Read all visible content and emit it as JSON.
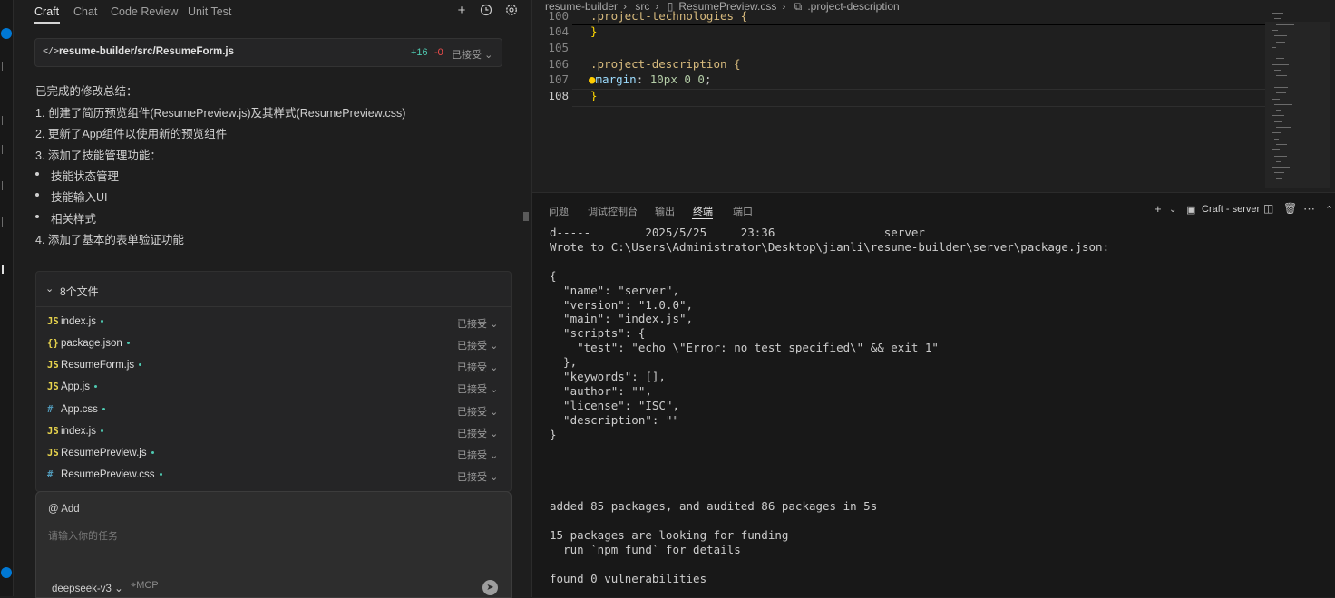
{
  "chat": {
    "tabs": [
      "Craft",
      "Chat",
      "Code Review",
      "Unit Test"
    ],
    "active_tab": "Craft",
    "header_icons": [
      "plus-icon",
      "history-icon",
      "settings-icon"
    ],
    "file_card": {
      "path": "resume-builder/src/ResumeForm.js",
      "added": "+16",
      "removed": "-0",
      "status": "已接受"
    },
    "summary": [
      "已完成的修改总结：",
      "1. 创建了简历预览组件(ResumePreview.js)及其样式(ResumePreview.css)",
      "2. 更新了App组件以使用新的预览组件",
      "3. 添加了技能管理功能："
    ],
    "bullets": [
      "技能状态管理",
      "技能输入UI",
      "相关样式"
    ],
    "summary_last": "4. 添加了基本的表单验证功能",
    "files_title": "8个文件",
    "files": [
      {
        "icon": "JS",
        "type": "js",
        "name": "index.js",
        "status": "已接受"
      },
      {
        "icon": "{}",
        "type": "json",
        "name": "package.json",
        "status": "已接受"
      },
      {
        "icon": "JS",
        "type": "js",
        "name": "ResumeForm.js",
        "status": "已接受"
      },
      {
        "icon": "JS",
        "type": "js",
        "name": "App.js",
        "status": "已接受"
      },
      {
        "icon": "#",
        "type": "css",
        "name": "App.css",
        "status": "已接受"
      },
      {
        "icon": "JS",
        "type": "js",
        "name": "index.js",
        "status": "已接受"
      },
      {
        "icon": "JS",
        "type": "js",
        "name": "ResumePreview.js",
        "status": "已接受"
      },
      {
        "icon": "#",
        "type": "css",
        "name": "ResumePreview.css",
        "status": "已接受"
      }
    ],
    "input": {
      "add_label": "@ Add",
      "placeholder": "请输入你的任务",
      "model": "deepseek-v3",
      "mcp": "MCP"
    }
  },
  "editor": {
    "breadcrumb": [
      "resume-builder",
      "src",
      "ResumePreview.css",
      ".project-description"
    ],
    "lines": [
      {
        "n": "100",
        "text": ".project-technologies {",
        "kind": "sel"
      },
      {
        "n": "104",
        "text": "}",
        "kind": "br"
      },
      {
        "n": "105",
        "text": "",
        "kind": "plain"
      },
      {
        "n": "106",
        "text": ".project-description {",
        "kind": "sel"
      },
      {
        "n": "107",
        "prop": "margin",
        "value": "10px 0 0",
        "kind": "decl"
      },
      {
        "n": "108",
        "text": "}",
        "kind": "br"
      }
    ]
  },
  "panel": {
    "tabs": [
      "问题",
      "调试控制台",
      "输出",
      "终端",
      "端口"
    ],
    "active_tab": "终端",
    "terminal_name": "Craft - server",
    "terminal_lines": [
      {
        "t": "d-----        2025/5/25     23:36                server"
      },
      {
        "t": "Wrote to C:\\Users\\Administrator\\Desktop\\jianli\\resume-builder\\server\\package.json:"
      },
      {
        "t": ""
      },
      {
        "t": "{"
      },
      {
        "t": "  \"name\": \"server\","
      },
      {
        "t": "  \"version\": \"1.0.0\","
      },
      {
        "t": "  \"main\": \"index.js\","
      },
      {
        "t": "  \"scripts\": {"
      },
      {
        "t": "    \"test\": \"echo \\\"Error: no test specified\\\" && exit 1\""
      },
      {
        "t": "  },"
      },
      {
        "t": "  \"keywords\": [],"
      },
      {
        "t": "  \"author\": \"\","
      },
      {
        "t": "  \"license\": \"ISC\","
      },
      {
        "t": "  \"description\": \"\""
      },
      {
        "t": "}"
      },
      {
        "t": ""
      },
      {
        "t": ""
      },
      {
        "t": ""
      },
      {
        "t": ""
      },
      {
        "t": "added 85 packages, and audited 86 packages in 5s"
      },
      {
        "t": ""
      },
      {
        "t": "15 packages are looking for funding"
      },
      {
        "t": "  run `npm fund` for details"
      },
      {
        "t": ""
      },
      {
        "t": "found 0 vulnerabilities"
      }
    ]
  },
  "colors": {
    "accent": "#0078d4",
    "added": "#4ec9b0",
    "removed": "#f14c4c",
    "css_selector": "#d7ba7d",
    "bracket": "#ffd700",
    "property": "#9cdcfe",
    "number": "#b5cea8"
  }
}
